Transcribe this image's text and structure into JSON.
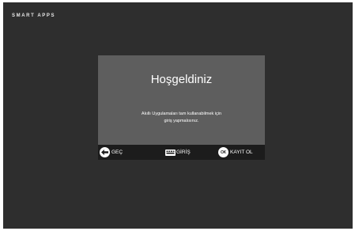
{
  "app": {
    "title": "SMART APPS"
  },
  "dialog": {
    "title": "Hoşgeldiniz",
    "message_line1": "Akıllı Uygulamaları tam kullanabilmek için",
    "message_line2": "giriş yapmalısınız.",
    "buttons": {
      "back": {
        "label": "GEÇ",
        "icon": "arrow-left-icon"
      },
      "login": {
        "label": "GİRİŞ",
        "icon": "keyboard-icon"
      },
      "signup": {
        "label": "KAYIT OL",
        "icon": "ok-icon",
        "icon_text": "OK"
      }
    }
  },
  "colors": {
    "background": "#2e2e2e",
    "dialog": "#5e5e5e",
    "button_bar": "#1c1c1c",
    "text": "#ffffff"
  }
}
